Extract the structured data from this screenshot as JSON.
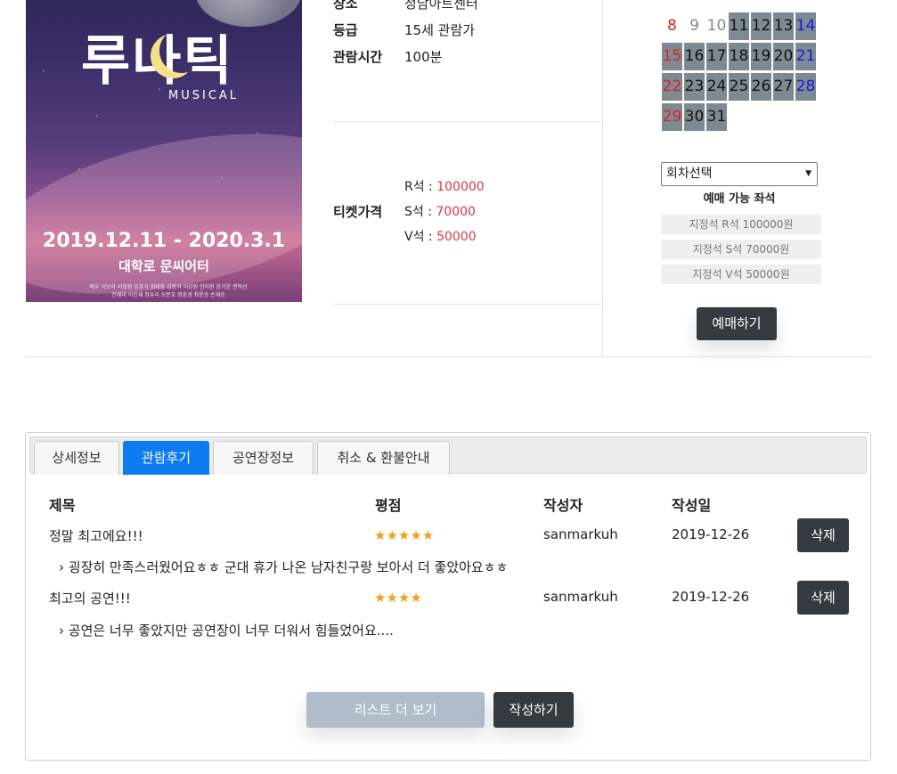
{
  "poster": {
    "logo_text": "루나틱",
    "subtitle": "MUSICAL",
    "dates": "2019.12.11 - 2020.3.1",
    "venue": "대학로 문씨어터",
    "credits": "배우 이보라 서영원 김훈식 최태웅 김동석 이강원 안지현 윤기운 권혁선 전혜미 이진재 정유리 오문호 명훈경 최윤승 손재승"
  },
  "info": {
    "place_label": "장소",
    "place_value": "청담아트센터",
    "grade_label": "등급",
    "grade_value": "15세 관람가",
    "runtime_label": "관람시간",
    "runtime_value": "100분",
    "price_label": "티켓가격",
    "prices": [
      {
        "seat": "R석 : ",
        "amount": "100000"
      },
      {
        "seat": "S석 : ",
        "amount": "70000"
      },
      {
        "seat": "V석 : ",
        "amount": "50000"
      }
    ]
  },
  "calendar": {
    "days": [
      "8",
      "9",
      "10",
      "11",
      "12",
      "13",
      "14",
      "15",
      "16",
      "17",
      "18",
      "19",
      "20",
      "21",
      "22",
      "23",
      "24",
      "25",
      "26",
      "27",
      "28",
      "29",
      "30",
      "31"
    ]
  },
  "booking": {
    "select_label": "회차선택",
    "available_title": "예매 가능 좌석",
    "seats": [
      "지정석 R석 100000원",
      "지정석 S석 70000원",
      "지정석 V석 50000원"
    ],
    "book_button": "예매하기"
  },
  "tabs": [
    {
      "label": "상세정보",
      "active": false
    },
    {
      "label": "관람후기",
      "active": true
    },
    {
      "label": "공연장정보",
      "active": false
    },
    {
      "label": "취소 & 환불안내",
      "active": false
    }
  ],
  "reviews": {
    "headers": {
      "title": "제목",
      "rating": "평점",
      "author": "작성자",
      "date": "작성일"
    },
    "rows": [
      {
        "title": "정말 최고에요!!!",
        "stars": "★★★★★",
        "author": "sanmarkuh",
        "date": "2019-12-26",
        "delete": "삭제",
        "comment": "›  굉장히 만족스러웠어요ㅎㅎ 군대 휴가 나온 남자친구랑 보아서 더 좋았아요ㅎㅎ"
      },
      {
        "title": "최고의 공연!!!",
        "stars": "★★★★",
        "author": "sanmarkuh",
        "date": "2019-12-26",
        "delete": "삭제",
        "comment": "›  공연은 너무 좋았지만 공연장이 너무 더워서 힘들었어요...."
      }
    ],
    "more_button": "리스트 더 보기",
    "write_button": "작성하기"
  }
}
